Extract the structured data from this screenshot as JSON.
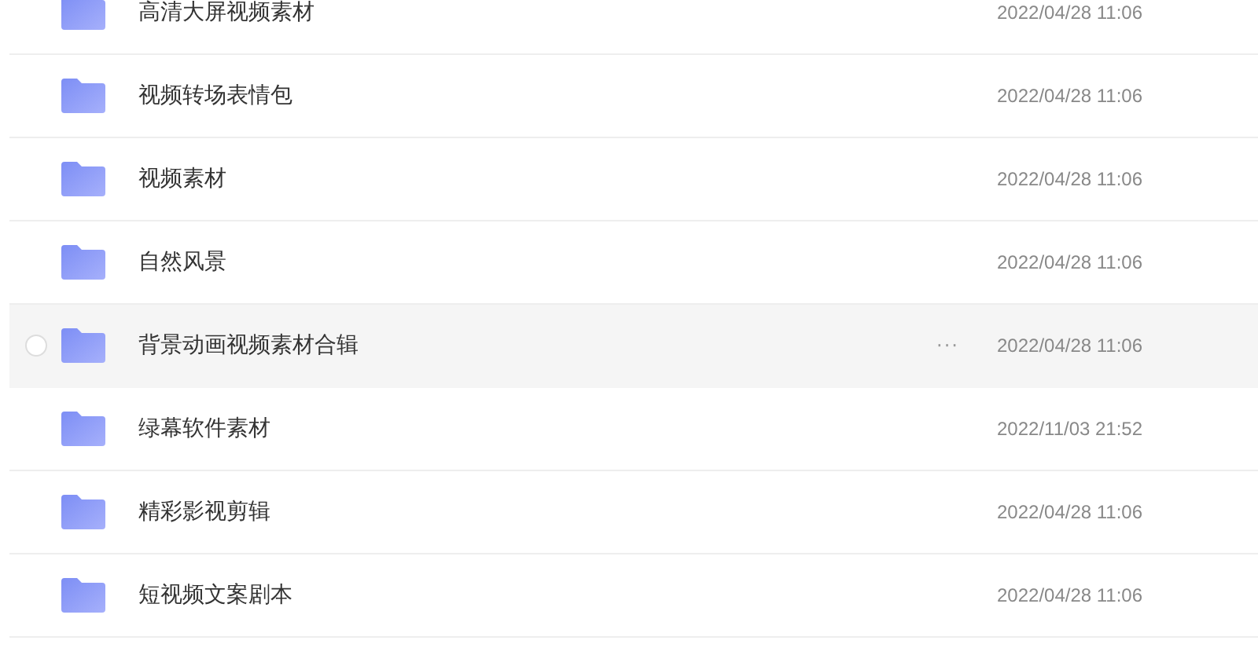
{
  "files": [
    {
      "name": "高清大屏视频素材",
      "date": "2022/04/28 11:06",
      "hovered": false
    },
    {
      "name": "视频转场表情包",
      "date": "2022/04/28 11:06",
      "hovered": false
    },
    {
      "name": "视频素材",
      "date": "2022/04/28 11:06",
      "hovered": false
    },
    {
      "name": "自然风景",
      "date": "2022/04/28 11:06",
      "hovered": false
    },
    {
      "name": "背景动画视频素材合辑",
      "date": "2022/04/28 11:06",
      "hovered": true,
      "actions": "···"
    },
    {
      "name": "绿幕软件素材",
      "date": "2022/11/03 21:52",
      "hovered": false
    },
    {
      "name": "精彩影视剪辑",
      "date": "2022/04/28 11:06",
      "hovered": false
    },
    {
      "name": "短视频文案剧本",
      "date": "2022/04/28 11:06",
      "hovered": false
    }
  ]
}
